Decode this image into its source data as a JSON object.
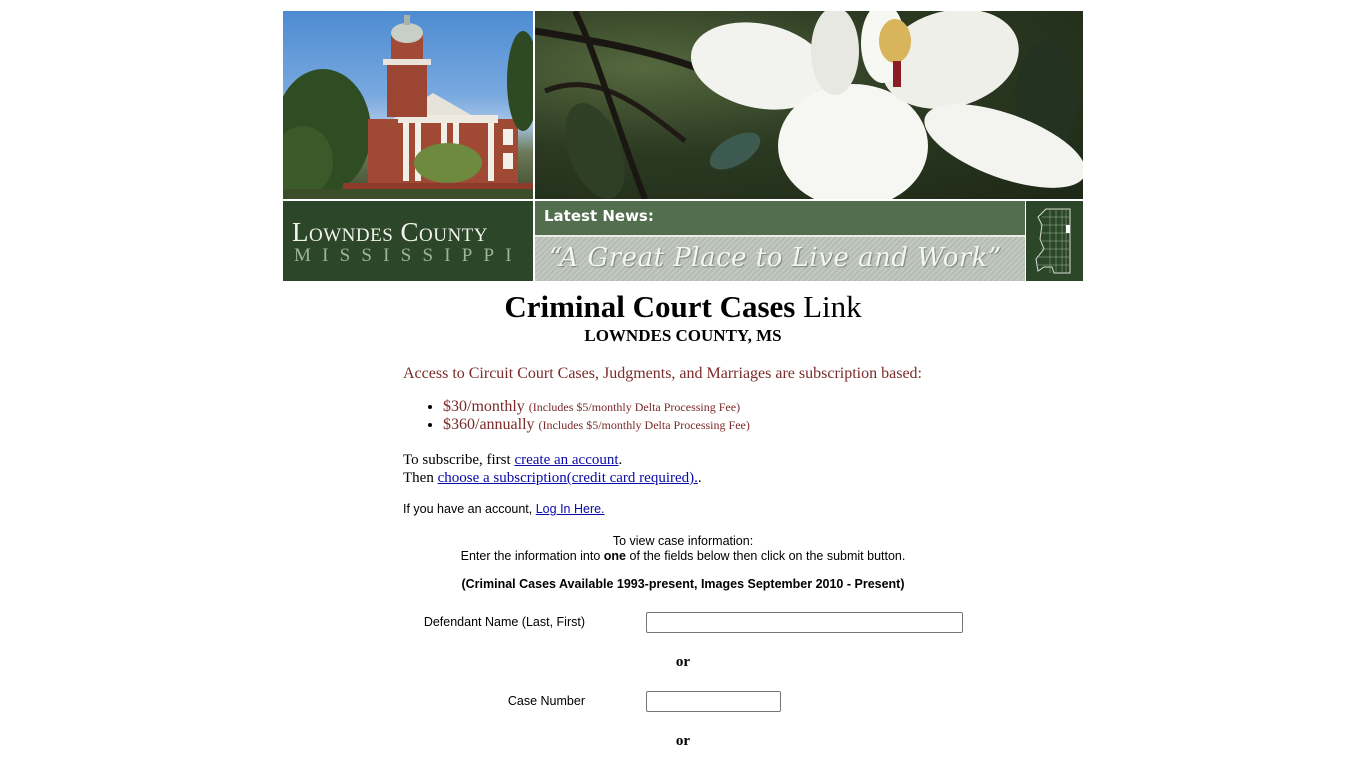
{
  "banner": {
    "logo_county": "Lowndes County",
    "logo_state": "MISSISSIPPI",
    "news_title": "Latest News:",
    "tagline": "“A Great Place to Live and Work”",
    "photos": [
      "courthouse-photo",
      "magnolia-photo"
    ],
    "map_icon": "mississippi-county-map-icon",
    "colors": {
      "dark_green": "#2b4628",
      "mid_green": "#526e4e",
      "tagline_gray": "#b5bdb3"
    }
  },
  "header": {
    "title_bold": "Criminal Court Cases",
    "title_regular": "Link",
    "subtitle": "LOWNDES COUNTY, MS"
  },
  "subscription": {
    "intro": "Access to Circuit Court Cases, Judgments, and Marriages are subscription based:",
    "plans": [
      {
        "price": "$30/monthly",
        "note": "(Includes $5/monthly Delta Processing Fee)"
      },
      {
        "price": "$360/annually",
        "note": "(Includes $5/monthly Delta Processing Fee)"
      }
    ],
    "text_color": "#7b2a2a",
    "step1_prefix": "To subscribe, first ",
    "step1_link": "create an account",
    "step1_suffix": ".",
    "step2_prefix": "Then ",
    "step2_link": "choose a subscription(credit card required).",
    "step2_suffix": ".",
    "login_prefix": "If you have an account, ",
    "login_link": "Log In Here."
  },
  "instructions": {
    "line1": "To view case information:",
    "line2_prefix": "Enter the information into ",
    "line2_bold": "one",
    "line2_suffix": " of the fields below then click on the submit button.",
    "availability": "(Criminal Cases Available 1993-present, Images September 2010 - Present)"
  },
  "form": {
    "defendant_label": "Defendant Name (Last, First)",
    "defendant_value": "",
    "or_label_1": "or",
    "case_number_label": "Case Number",
    "case_number_value": "",
    "or_label_2": "or"
  }
}
